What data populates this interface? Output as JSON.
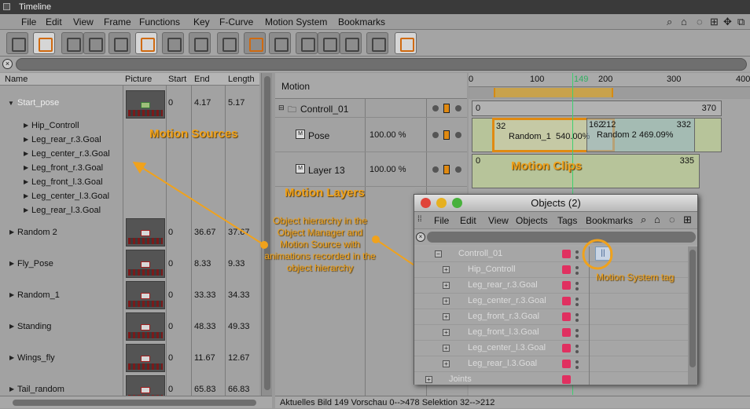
{
  "window": {
    "title": "Timeline"
  },
  "menu": [
    "File",
    "Edit",
    "View",
    "Frame",
    "Functions",
    "Key",
    "F-Curve",
    "Motion System",
    "Bookmarks"
  ],
  "colors": {
    "accent": "#f0a21c",
    "playhead": "#3ed070",
    "clip_fill": "#b7c49a",
    "tag_red": "#e03060"
  },
  "left_header": {
    "name": "Name",
    "picture": "Picture",
    "start": "Start",
    "end": "End",
    "length": "Length"
  },
  "sources": [
    {
      "name": "Start_pose",
      "start": "0",
      "end": "4.17",
      "length": "5.17",
      "children": [
        "Hip_Controll",
        "Leg_rear_r.3.Goal",
        "Leg_center_r.3.Goal",
        "Leg_front_r.3.Goal",
        "Leg_front_l.3.Goal",
        "Leg_center_l.3.Goal",
        "Leg_rear_l.3.Goal"
      ]
    },
    {
      "name": "Random 2",
      "start": "0",
      "end": "36.67",
      "length": "37.67"
    },
    {
      "name": "Fly_Pose",
      "start": "0",
      "end": "8.33",
      "length": "9.33"
    },
    {
      "name": "Random_1",
      "start": "0",
      "end": "33.33",
      "length": "34.33"
    },
    {
      "name": "Standing",
      "start": "0",
      "end": "48.33",
      "length": "49.33"
    },
    {
      "name": "Wings_fly",
      "start": "0",
      "end": "11.67",
      "length": "12.67"
    },
    {
      "name": "Tail_random",
      "start": "0",
      "end": "65.83",
      "length": "66.83"
    }
  ],
  "motion": {
    "header": "Motion",
    "group": "Controll_01",
    "layers": [
      {
        "name": "Pose",
        "weight": "100.00 %"
      },
      {
        "name": "Layer  13",
        "weight": "100.00 %"
      }
    ]
  },
  "ruler": {
    "ticks": [
      "0",
      "100",
      "200",
      "300",
      "400"
    ],
    "current": "149"
  },
  "clips": {
    "row1": {
      "start": "0",
      "end": "370"
    },
    "row2": {
      "c1_start": "32",
      "c1_label": "Random_1",
      "c1_value": "540.00%",
      "c2_start": "162",
      "c2_end": "212",
      "c2_label": "Random 2",
      "c2_value": "469.09%",
      "c2_stop": "332"
    },
    "row3": {
      "start": "0",
      "end": "335"
    }
  },
  "status": {
    "text": "Aktuelles Bild  149  Vorschau  0-->478    Selektion 32-->212"
  },
  "annotations": {
    "sources": "Motion Sources",
    "clips": "Motion Clips",
    "layers": "Motion Layers",
    "hierarchy": "Object hierarchy in the Object Manager and Motion Source with animations recorded in the object hierarchy",
    "tag": "Motion System tag"
  },
  "objects_window": {
    "title": "Objects (2)",
    "menu": [
      "File",
      "Edit",
      "View",
      "Objects",
      "Tags",
      "Bookmarks"
    ],
    "items": [
      "Controll_01",
      "Hip_Controll",
      "Leg_rear_r.3.Goal",
      "Leg_center_r.3.Goal",
      "Leg_front_r.3.Goal",
      "Leg_front_l.3.Goal",
      "Leg_center_l.3.Goal",
      "Leg_rear_l.3.Goal",
      "Joints"
    ]
  }
}
